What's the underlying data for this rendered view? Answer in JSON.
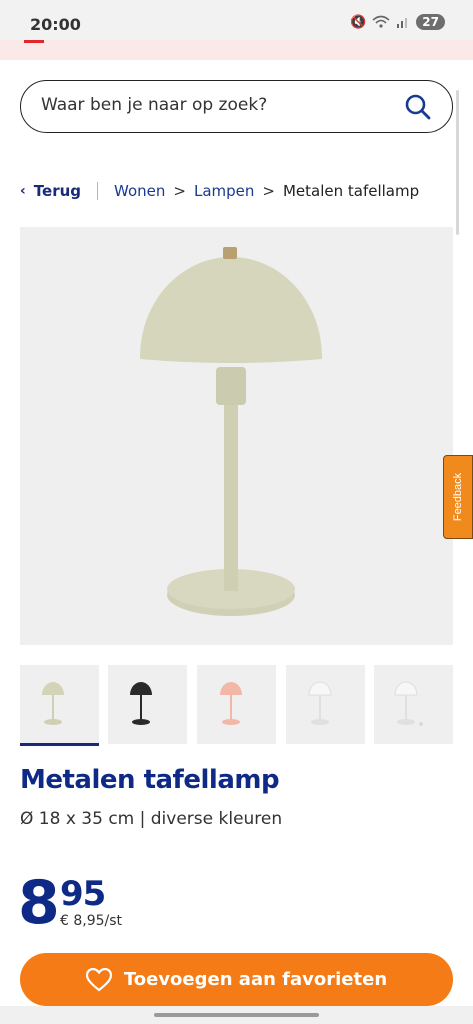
{
  "status_bar": {
    "time": "20:00",
    "battery": "27"
  },
  "search": {
    "placeholder": "Waar ben je naar op zoek?"
  },
  "breadcrumb": {
    "back_label": "Terug",
    "items": [
      "Wonen",
      "Lampen",
      "Metalen tafellamp"
    ]
  },
  "feedback": {
    "label": "Feedback"
  },
  "product": {
    "title": "Metalen tafellamp",
    "subtitle": "Ø 18 x 35 cm | diverse kleuren",
    "price_whole": "8",
    "price_cents": "95",
    "price_unit": "€ 8,95/st"
  },
  "thumbnails": [
    {
      "color": "#d3d3b8",
      "selected": true
    },
    {
      "color": "#2a2a2a",
      "selected": false
    },
    {
      "color": "#f2b7a6",
      "selected": false
    },
    {
      "color": "#f6f6f6",
      "selected": false
    },
    {
      "color": "#f6f6f6",
      "selected": false
    }
  ],
  "favorite_button": {
    "label": "Toevoegen aan favorieten"
  },
  "colors": {
    "brand_blue": "#0e2a86",
    "accent_orange": "#f47b15",
    "lamp_green": "#d3d3b8"
  }
}
